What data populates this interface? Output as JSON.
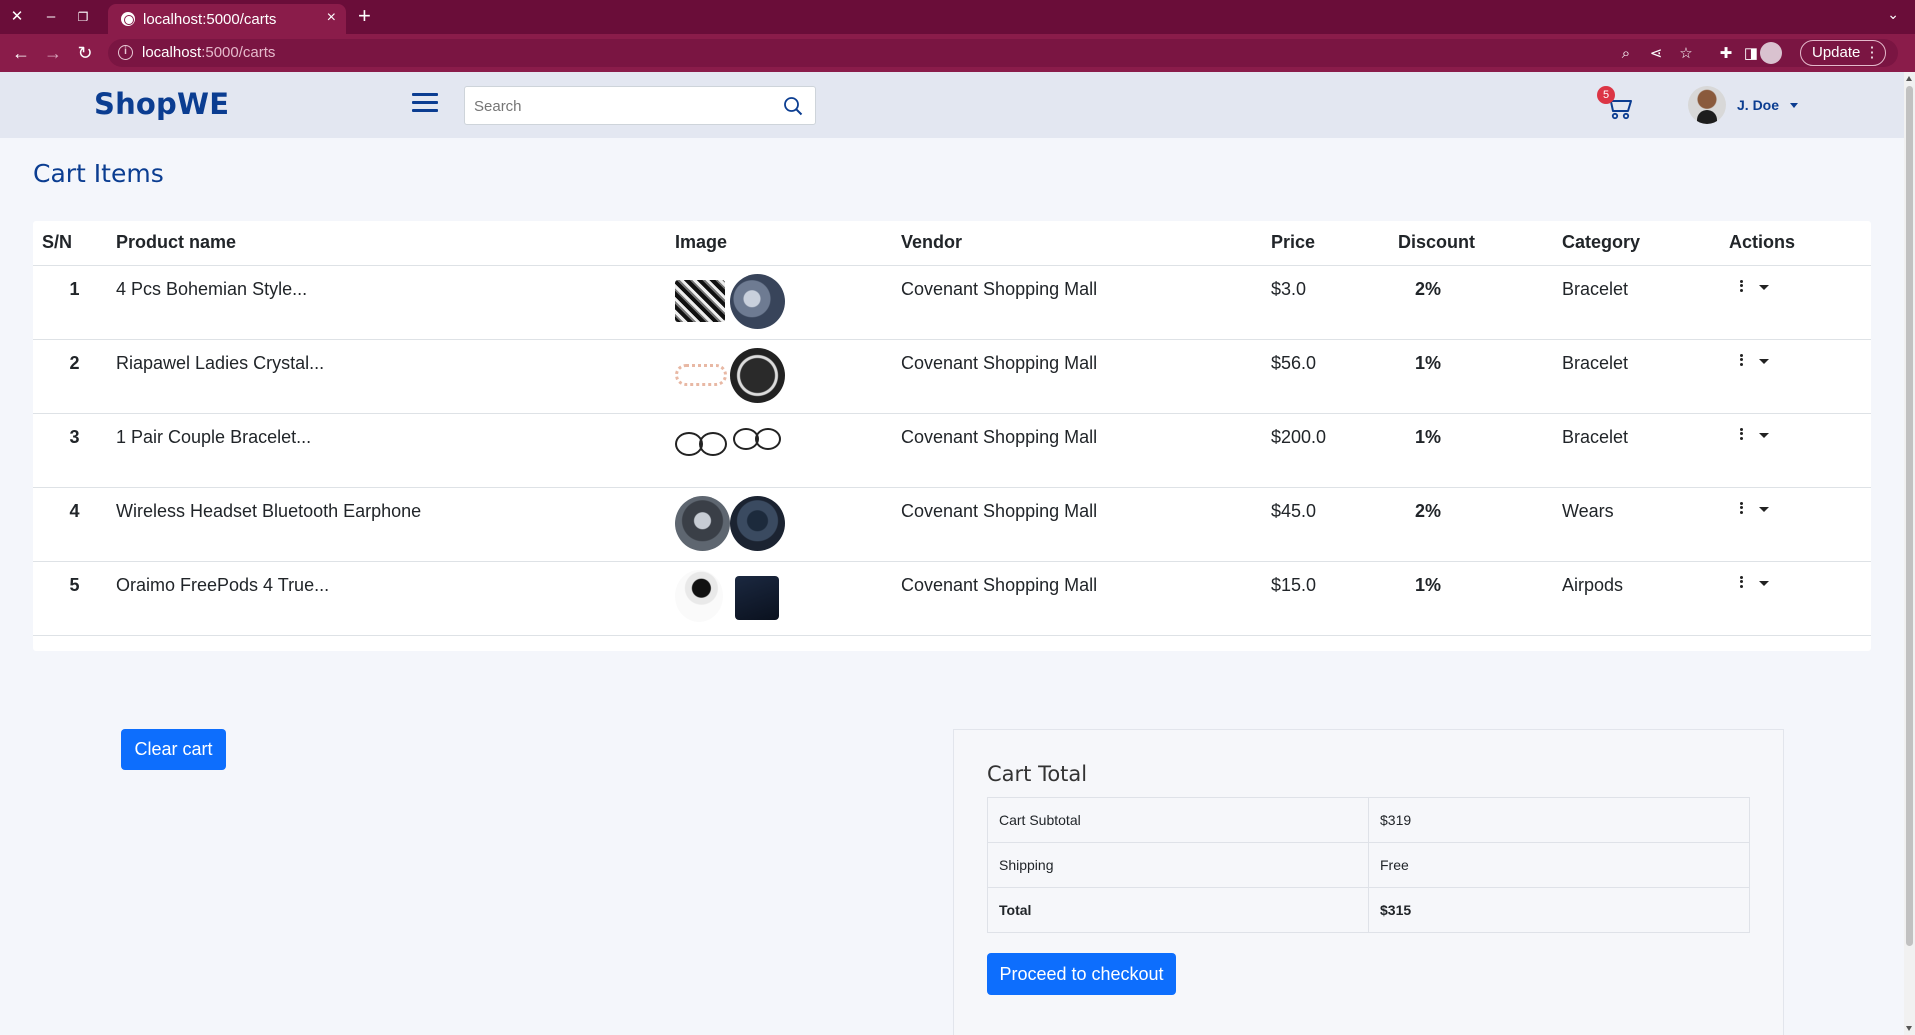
{
  "browser": {
    "tab_title": "localhost:5000/carts",
    "url_host": "localhost",
    "url_path": ":5000/carts",
    "update_label": "Update",
    "close_glyph": "×",
    "newtab_glyph": "+"
  },
  "navbar": {
    "brand": "ShopWE",
    "search_placeholder": "Search",
    "cart_count": "5",
    "user_name": "J. Doe"
  },
  "page": {
    "title": "Cart Items"
  },
  "cart_table": {
    "headers": [
      "S/N",
      "Product name",
      "Image",
      "Vendor",
      "Price",
      "Discount",
      "Category",
      "Actions"
    ],
    "rows": [
      {
        "sn": "1",
        "name": "4 Pcs Bohemian Style...",
        "vendor": "Covenant Shopping Mall",
        "price": "$3.0",
        "discount": "2%",
        "category": "Bracelet"
      },
      {
        "sn": "2",
        "name": "Riapawel Ladies Crystal...",
        "vendor": "Covenant Shopping Mall",
        "price": "$56.0",
        "discount": "1%",
        "category": "Bracelet"
      },
      {
        "sn": "3",
        "name": "1 Pair Couple Bracelet...",
        "vendor": "Covenant Shopping Mall",
        "price": "$200.0",
        "discount": "1%",
        "category": "Bracelet"
      },
      {
        "sn": "4",
        "name": "Wireless Headset Bluetooth Earphone",
        "vendor": "Covenant Shopping Mall",
        "price": "$45.0",
        "discount": "2%",
        "category": "Wears"
      },
      {
        "sn": "5",
        "name": "Oraimo FreePods 4 True...",
        "vendor": "Covenant Shopping Mall",
        "price": "$15.0",
        "discount": "1%",
        "category": "Airpods"
      }
    ]
  },
  "actions": {
    "clear_cart": "Clear cart",
    "proceed_checkout": "Proceed to checkout"
  },
  "cart_total": {
    "title": "Cart Total",
    "rows": [
      {
        "label": "Cart Subtotal",
        "value": "$319"
      },
      {
        "label": "Shipping",
        "value": "Free"
      },
      {
        "label": "Total",
        "value": "$315"
      }
    ]
  },
  "colors": {
    "browser_frame": "#6a0d39",
    "brand": "#0b3d91",
    "primary": "#0d6efd",
    "badge": "#dc3545"
  }
}
